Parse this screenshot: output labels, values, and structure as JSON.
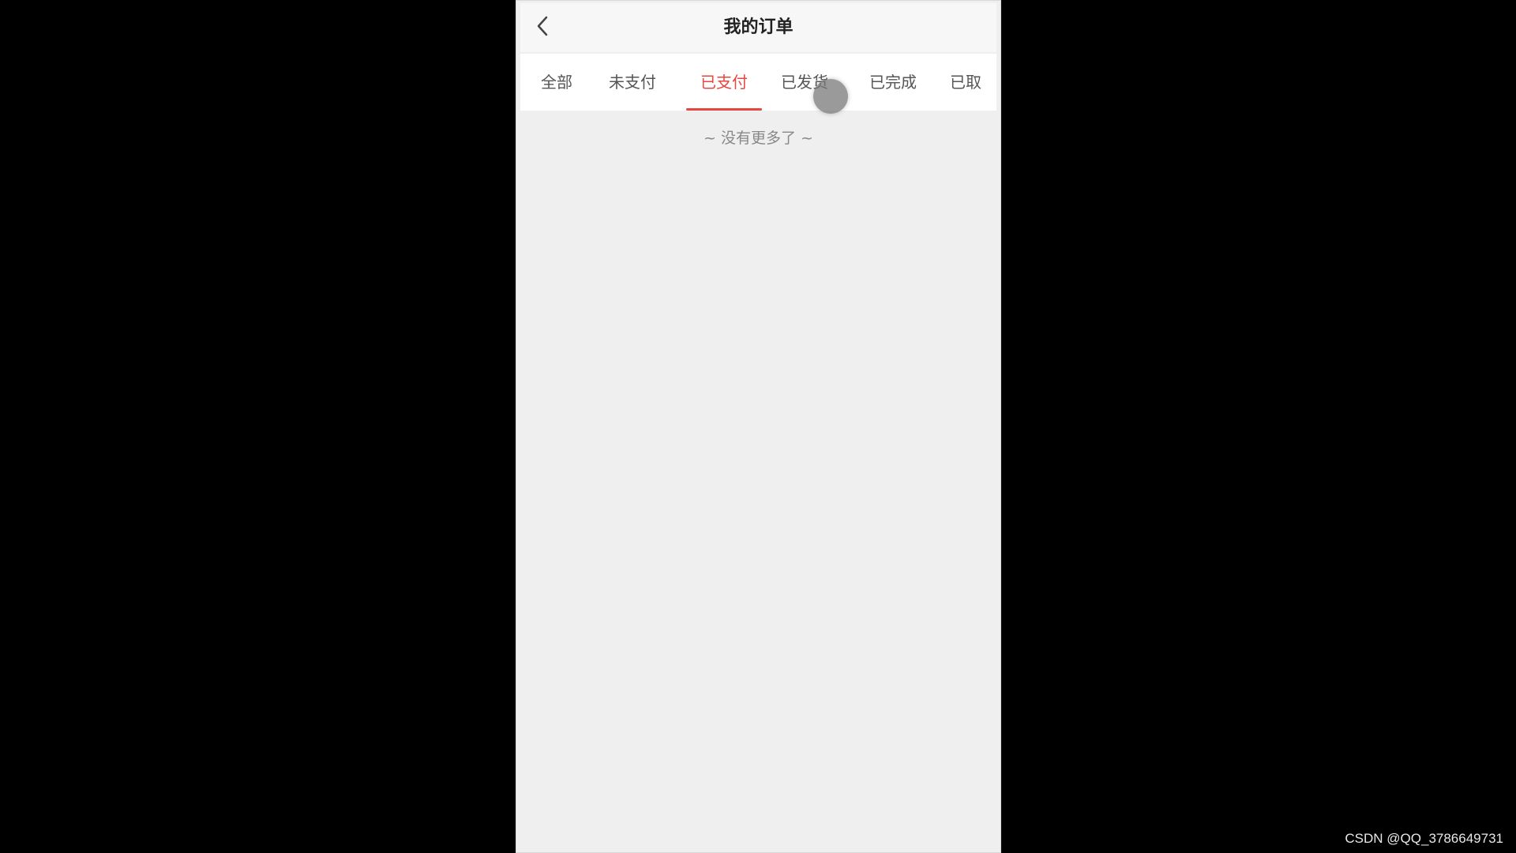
{
  "navbar": {
    "title": "我的订单",
    "back_icon": "chevron-left-icon"
  },
  "tabs": [
    {
      "label": "全部",
      "active": false
    },
    {
      "label": "未支付",
      "active": false
    },
    {
      "label": "已支付",
      "active": true
    },
    {
      "label": "已发货",
      "active": false
    },
    {
      "label": "已完成",
      "active": false
    },
    {
      "label": "已取",
      "active": false
    }
  ],
  "content": {
    "empty_text": "~ 没有更多了 ~"
  },
  "watermark": "CSDN @QQ_3786649731",
  "colors": {
    "accent": "#e8473f",
    "background": "#efefef",
    "frame": "#000000"
  }
}
